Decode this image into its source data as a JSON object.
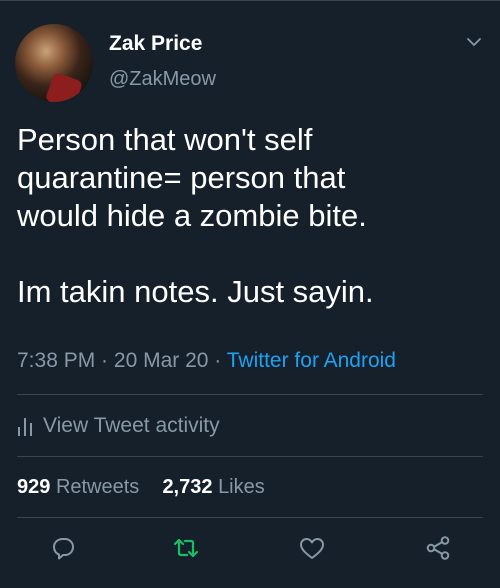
{
  "colors": {
    "background": "#15202b",
    "secondary_text": "#8899a6",
    "link": "#1da1f2",
    "retweet": "#17bf63",
    "divider": "#38444d"
  },
  "author": {
    "display_name": "Zak Price",
    "handle": "@ZakMeow"
  },
  "tweet": {
    "text": "Person that won't self\nquarantine= person that\nwould hide a zombie bite.\n\nIm takin notes. Just sayin.",
    "time": "7:38 PM",
    "date": "20 Mar 20",
    "source": "Twitter for Android"
  },
  "activity_label": "View Tweet activity",
  "stats": {
    "retweets_count": "929",
    "retweets_label": "Retweets",
    "likes_count": "2,732",
    "likes_label": "Likes"
  },
  "icons": {
    "chevron": "chevron-down-icon",
    "activity": "bar-chart-icon",
    "reply": "reply-icon",
    "retweet": "retweet-icon",
    "like": "heart-icon",
    "share": "share-icon"
  }
}
